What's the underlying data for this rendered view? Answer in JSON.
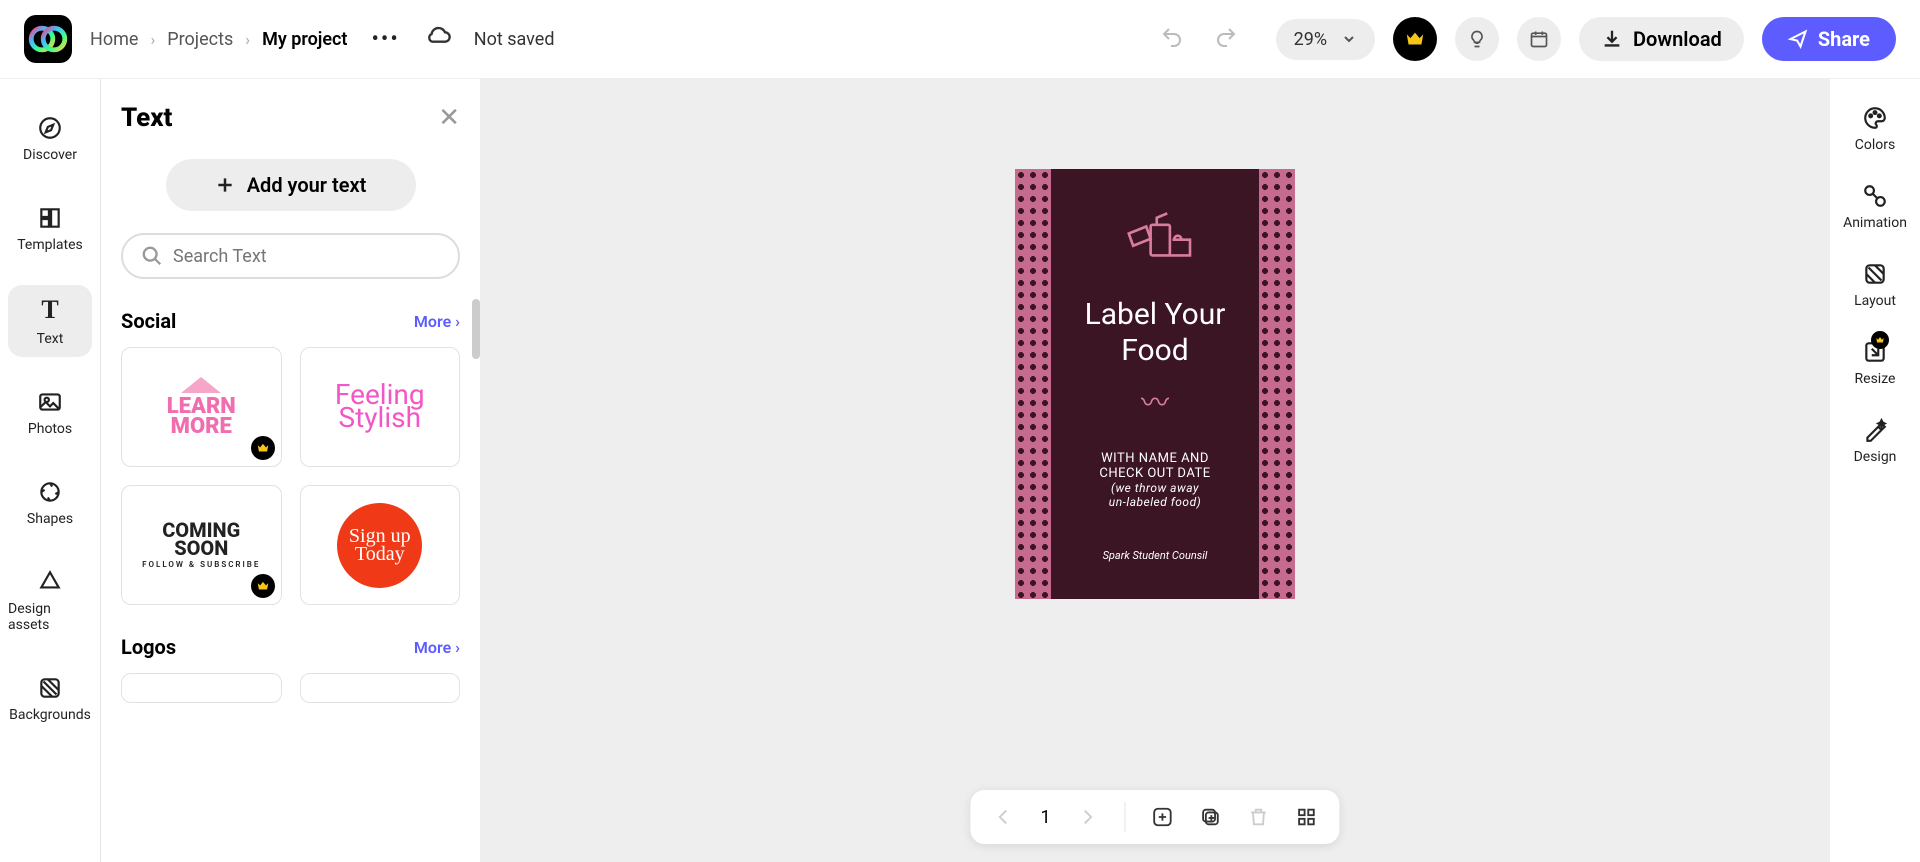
{
  "breadcrumbs": {
    "home": "Home",
    "projects": "Projects",
    "current": "My project"
  },
  "header": {
    "notSaved": "Not saved",
    "zoom": "29%",
    "download": "Download",
    "share": "Share"
  },
  "leftRail": {
    "discover": "Discover",
    "templates": "Templates",
    "text": "Text",
    "photos": "Photos",
    "shapes": "Shapes",
    "designAssets": "Design assets",
    "backgrounds": "Backgrounds"
  },
  "panel": {
    "title": "Text",
    "addText": "Add your text",
    "searchPlaceholder": "Search Text",
    "sections": {
      "social": {
        "title": "Social",
        "more": "More",
        "cards": {
          "learnMore1": "LEARN",
          "learnMore2": "MORE",
          "feeling1": "Feeling",
          "feeling2": "Stylish",
          "coming1": "COMING",
          "coming2": "SOON",
          "comingSub": "FOLLOW & SUBSCRIBE",
          "signup": "Sign up\nToday"
        }
      },
      "logos": {
        "title": "Logos",
        "more": "More"
      }
    }
  },
  "poster": {
    "title1": "Label Your",
    "title2": "Food",
    "sub1": "WITH NAME AND",
    "sub2": "CHECK OUT DATE",
    "sub3": "(we throw away",
    "sub4": "un-labeled food)",
    "footer": "Spark Student Counsil"
  },
  "pageControls": {
    "page": "1"
  },
  "rightRail": {
    "colors": "Colors",
    "animation": "Animation",
    "layout": "Layout",
    "resize": "Resize",
    "design": "Design"
  }
}
